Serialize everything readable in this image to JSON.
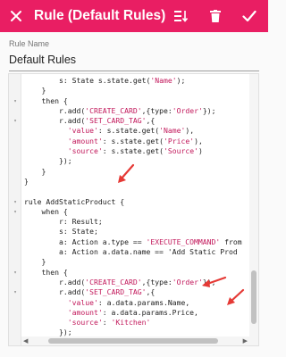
{
  "appbar": {
    "title": "Rule (Default Rules)",
    "close_icon": "close-icon",
    "actions": [
      "sort-icon",
      "delete-icon",
      "check-icon"
    ]
  },
  "field": {
    "label": "Rule Name",
    "value": "Default Rules"
  },
  "editor": {
    "lines": [
      {
        "fold": "",
        "code": "        s: State s.state.get('Name');"
      },
      {
        "fold": "",
        "code": "    }"
      },
      {
        "fold": "▾",
        "code": "    then {"
      },
      {
        "fold": "",
        "code": "        r.add('CREATE_CARD',{type:'Order'});"
      },
      {
        "fold": "▾",
        "code": "        r.add('SET_CARD_TAG',{"
      },
      {
        "fold": "",
        "code": "          'value': s.state.get('Name'),"
      },
      {
        "fold": "",
        "code": "          'amount': s.state.get('Price'),"
      },
      {
        "fold": "",
        "code": "          'source': s.state.get('Source')"
      },
      {
        "fold": "",
        "code": "        });"
      },
      {
        "fold": "",
        "code": "    }"
      },
      {
        "fold": "",
        "code": "}"
      },
      {
        "fold": "",
        "code": ""
      },
      {
        "fold": "▾",
        "code": "rule AddStaticProduct {"
      },
      {
        "fold": "▾",
        "code": "    when {"
      },
      {
        "fold": "",
        "code": "        r: Result;"
      },
      {
        "fold": "",
        "code": "        s: State;"
      },
      {
        "fold": "",
        "code": "        a: Action a.type == 'EXECUTE_COMMAND' from"
      },
      {
        "fold": "",
        "code": "        a: Action a.data.name == 'Add Static Prod"
      },
      {
        "fold": "",
        "code": "    }"
      },
      {
        "fold": "▾",
        "code": "    then {"
      },
      {
        "fold": "",
        "code": "        r.add('CREATE_CARD',{type:'Order'});"
      },
      {
        "fold": "▾",
        "code": "        r.add('SET_CARD_TAG',{"
      },
      {
        "fold": "",
        "code": "          'value': a.data.params.Name,"
      },
      {
        "fold": "",
        "code": "          'amount': a.data.params.Price,"
      },
      {
        "fold": "",
        "code": "          'source': 'Kitchen'"
      },
      {
        "fold": "",
        "code": "        });"
      },
      {
        "fold": "",
        "code": "    }"
      },
      {
        "fold": "",
        "code": "}"
      }
    ]
  },
  "colors": {
    "appbar": "#e91e63",
    "annotation": "#e53935",
    "string": "#c2185b"
  }
}
